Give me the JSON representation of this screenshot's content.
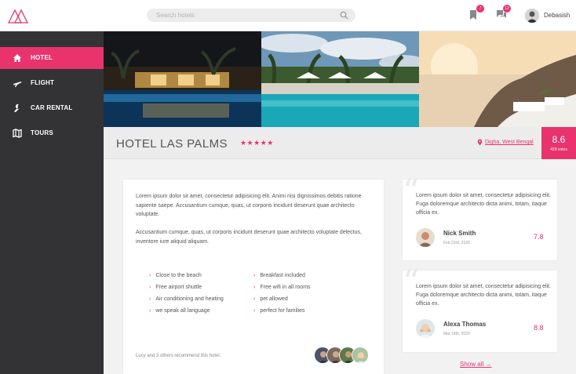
{
  "header": {
    "search_placeholder": "Search hotels",
    "bookmarks_badge": "7",
    "messages_badge": "12",
    "username": "Debasish"
  },
  "sidebar": {
    "items": [
      {
        "label": "HOTEL",
        "icon": "home-icon",
        "active": true
      },
      {
        "label": "FLIGHT",
        "icon": "plane-icon",
        "active": false
      },
      {
        "label": "CAR RENTAL",
        "icon": "wrench-icon",
        "active": false
      },
      {
        "label": "TOURS",
        "icon": "map-icon",
        "active": false
      }
    ]
  },
  "hotel": {
    "name": "HOTEL LAS PALMS",
    "stars": "★★★★★",
    "location": "Digha, West Bengal",
    "score": "8.6",
    "votes": "429 votes"
  },
  "description": {
    "paragraph_1": "Lorem ipsum dolor sit amet, consectetur adipisicing elit. Animi nisi dignissimos debitis ratione sapiente saepe. Accusantium cumque, quas, ut corporis incidunt deserunt quae architecto voluptate.",
    "paragraph_2": "Accusantium cumque, quas, ut corporis incidunt deserunt quae architecto voluptate delectus, inventore iure aliquid aliquam.",
    "amenities_left": [
      "Close to the beach",
      "Free airport shuttle",
      "Air conditioning and heating",
      "we speak all language"
    ],
    "amenities_right": [
      "Breakfast included",
      "Free wifi in all rooms",
      "pet allowed",
      "perfect for families"
    ],
    "recommend_text": "Lucy and 3 others recommend this hotel."
  },
  "reviews": [
    {
      "text": "Lorem ipsum dolor sit amet, consectetur adipisicing elit. Fuga doloremque architecto dicta animi, totam, itaque officia ex.",
      "name": "Nick Smith",
      "date": "Feb 23rd, 2020",
      "score": "7.8"
    },
    {
      "text": "Lorem ipsum dolor sit amet, consectetur adipisicing elit. Fuga doloremque architecto dicta animi, totam, itaque officia ex.",
      "name": "Alexa Thomas",
      "date": "Mar 19th, 2020",
      "score": "8.8"
    }
  ],
  "show_all": "Show all →",
  "colors": {
    "accent": "#e8336d",
    "sidebar": "#333335"
  }
}
